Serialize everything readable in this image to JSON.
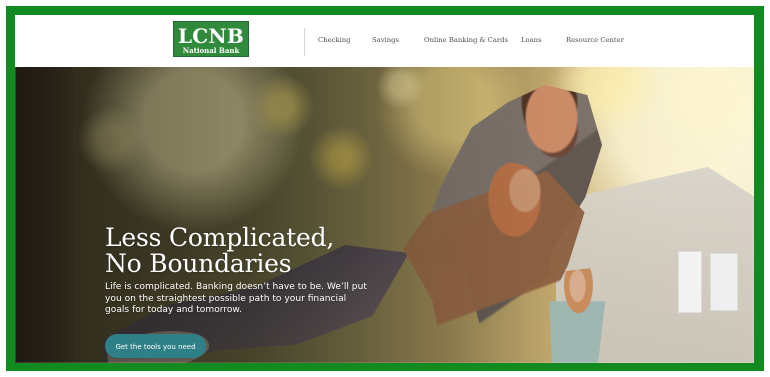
{
  "header": {
    "logo_main": "LCNB",
    "logo_sub": "National Bank",
    "nav": [
      {
        "label": "Checking"
      },
      {
        "label": "Savings"
      },
      {
        "label": "Online Banking & Cards"
      },
      {
        "label": "Loans"
      },
      {
        "label": "Resource Center"
      }
    ]
  },
  "hero": {
    "title_line_1": "Less Complicated,",
    "title_line_2": "No Boundaries",
    "description": "Life is complicated. Banking doesn’t have to be. We’ll put you on the straightest possible path to your financial goals for today and tomorrow.",
    "button_label": "Get the tools you need"
  },
  "colors": {
    "brand_green": "#2f8a3c",
    "border_green": "#118a1f",
    "button_teal": "#2f7f86"
  },
  "icons": {
    "logo": "lcnb-logo-icon"
  }
}
